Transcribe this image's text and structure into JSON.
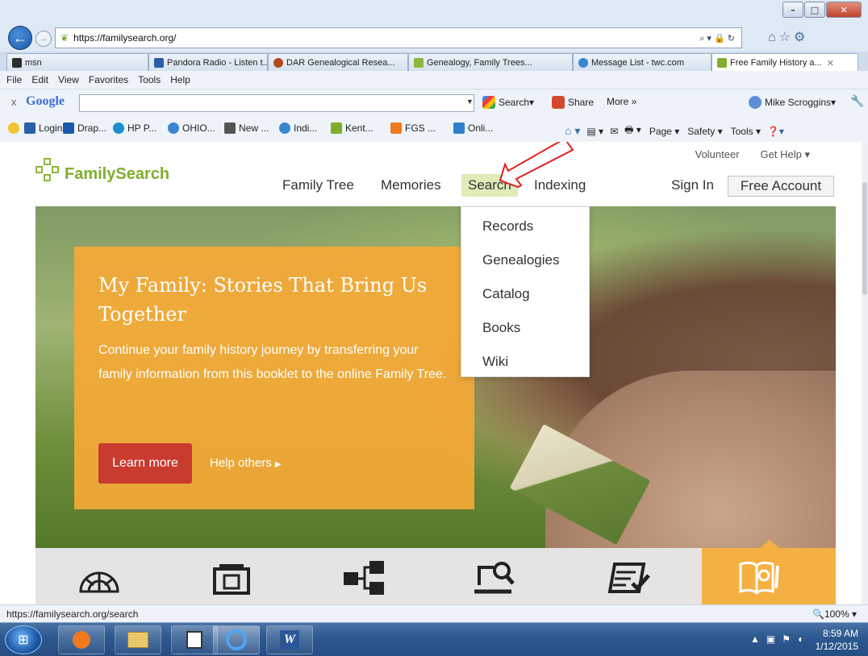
{
  "browser": {
    "url": "https://familysearch.org/",
    "tabs": [
      {
        "label": "msn",
        "color": "#2d2d2d"
      },
      {
        "label": "Pandora Radio - Listen t...",
        "color": "#2a5ea6"
      },
      {
        "label": "DAR Genealogical Resea...",
        "color": "#b14a1c"
      },
      {
        "label": "Genealogy, Family Trees...",
        "color": "#8cb83a"
      },
      {
        "label": "Message List - twc.com",
        "color": "#3b86d1"
      },
      {
        "label": "Free Family History a...",
        "color": "#7fae2e"
      }
    ],
    "menu": [
      "File",
      "Edit",
      "View",
      "Favorites",
      "Tools",
      "Help"
    ],
    "google_toolbar": {
      "close": "x",
      "logo": "Google",
      "search_label": "Search",
      "share_label": "Share",
      "more_label": "More »",
      "user": "Mike Scroggins"
    },
    "favorites": [
      {
        "label": "Login",
        "color": "#2d5fa8"
      },
      {
        "label": "Drap...",
        "color": "#1b5aa8"
      },
      {
        "label": "HP P...",
        "color": "#1a8ed1"
      },
      {
        "label": "OHIO...",
        "color": "#3b86d1"
      },
      {
        "label": "New ...",
        "color": "#555555"
      },
      {
        "label": "Indi...",
        "color": "#3b86d1"
      },
      {
        "label": "Kent...",
        "color": "#7fae2e"
      },
      {
        "label": "FGS ...",
        "color": "#f07a1f"
      },
      {
        "label": "Onli...",
        "color": "#2d7fc9"
      }
    ],
    "command_bar": [
      "Page",
      "Safety",
      "Tools"
    ],
    "status_url": "https://familysearch.org/search",
    "zoom": "100%"
  },
  "site": {
    "logo_text": "FamilySearch",
    "util_links": [
      "Volunteer",
      "Get Help"
    ],
    "nav": [
      "Family Tree",
      "Memories",
      "Search",
      "Indexing"
    ],
    "sign_in": "Sign In",
    "free_account": "Free Account",
    "search_menu": [
      "Records",
      "Genealogies",
      "Catalog",
      "Books",
      "Wiki"
    ],
    "hero": {
      "title": "My Family: Stories That Bring Us Together",
      "body": "Continue your family history journey by transferring your family information from this booklet to the online Family Tree.",
      "cta": "Learn more",
      "secondary": "Help others"
    }
  },
  "taskbar": {
    "time": "8:59 AM",
    "date": "1/12/2015"
  },
  "colors": {
    "brand_green": "#7fae2e",
    "hero_card": "#f4a937",
    "cta_red": "#c93a2f",
    "nav_active": "#dfecb8",
    "annotation_red": "#e02020"
  }
}
